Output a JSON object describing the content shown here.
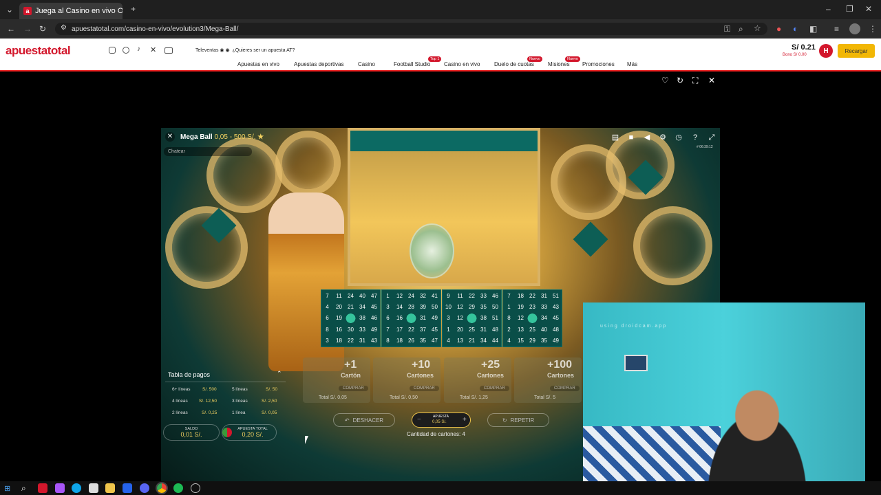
{
  "browser": {
    "tab_title": "Juega al Casino en vivo Onl",
    "url": "apuestatotal.com/casino-en-vivo/evolution3/Mega-Ball/",
    "favicon": "a"
  },
  "site": {
    "logo": "apuestatotal",
    "tele": "Televentas",
    "ask": "¿Quieres ser un apuesta AT?",
    "nav": [
      "Apuestas en vivo",
      "Apuestas deportivas",
      "Casino",
      "Football Studio",
      "Casino en vivo",
      "Duelo de cuotas",
      "Misiones",
      "Promociones",
      "Más"
    ],
    "badges": {
      "top": "Top 1",
      "nuevo1": "Nuevo",
      "nuevo2": "Nuevo"
    },
    "balance": "S/ 0.21",
    "bonus": "Bono S/ 0.00",
    "avatar": "H",
    "recharge": "Recargar"
  },
  "game": {
    "title": "Mega Ball",
    "limits": "0,05 - 500 S/.",
    "chat_placeholder": "Chatear",
    "round_id": "# 06:39:12",
    "cards": [
      [
        [
          7,
          11,
          24,
          40,
          47
        ],
        [
          4,
          20,
          21,
          34,
          45
        ],
        [
          6,
          19,
          "",
          38,
          46
        ],
        [
          8,
          16,
          30,
          33,
          49
        ],
        [
          3,
          18,
          22,
          31,
          43
        ]
      ],
      [
        [
          1,
          12,
          24,
          32,
          41
        ],
        [
          3,
          14,
          28,
          39,
          50
        ],
        [
          6,
          16,
          "",
          31,
          49
        ],
        [
          7,
          17,
          22,
          37,
          45
        ],
        [
          8,
          18,
          26,
          35,
          47
        ]
      ],
      [
        [
          9,
          11,
          22,
          33,
          46
        ],
        [
          10,
          12,
          29,
          35,
          50
        ],
        [
          3,
          12,
          "",
          38,
          51
        ],
        [
          1,
          20,
          25,
          31,
          48
        ],
        [
          4,
          13,
          21,
          34,
          44
        ]
      ],
      [
        [
          7,
          18,
          22,
          31,
          51
        ],
        [
          1,
          19,
          23,
          33,
          43
        ],
        [
          8,
          12,
          "",
          34,
          45
        ],
        [
          2,
          13,
          25,
          40,
          48
        ],
        [
          4,
          15,
          29,
          35,
          49
        ]
      ]
    ],
    "packs": [
      {
        "num": "+1",
        "label": "Cartón",
        "buy": "COMPRAR",
        "total": "Total S/. 0,05"
      },
      {
        "num": "+10",
        "label": "Cartones",
        "buy": "COMPRAR",
        "total": "Total S/. 0,50"
      },
      {
        "num": "+25",
        "label": "Cartones",
        "buy": "COMPRAR",
        "total": "Total S/. 1,25"
      },
      {
        "num": "+100",
        "label": "Cartones",
        "buy": "COMPRAR",
        "total": "Total S/. 5"
      }
    ],
    "paytable": {
      "title": "Tabla de pagos",
      "rows": [
        {
          "l1": "6+ líneas",
          "v1": "S/. 500",
          "l2": "5 líneas",
          "v2": "S/. 50"
        },
        {
          "l1": "4 líneas",
          "v1": "S/. 12,50",
          "l2": "3 líneas",
          "v2": "S/. 2,50"
        },
        {
          "l1": "2 líneas",
          "v1": "S/. 0,25",
          "l2": "1 línea",
          "v2": "S/. 0,05"
        }
      ]
    },
    "undo": "DESHACER",
    "repeat": "REPETIR",
    "bet_label": "APUESTA",
    "bet_value": "0,05 S/.",
    "cards_count": "Cantidad de cartones: 4",
    "saldo_label": "SALDO",
    "saldo_value": "0,01 S/.",
    "total_label": "APUESTA TOTAL",
    "total_value": "0,20 S/."
  },
  "webcam": {
    "watermark": "using droidcam.app"
  }
}
